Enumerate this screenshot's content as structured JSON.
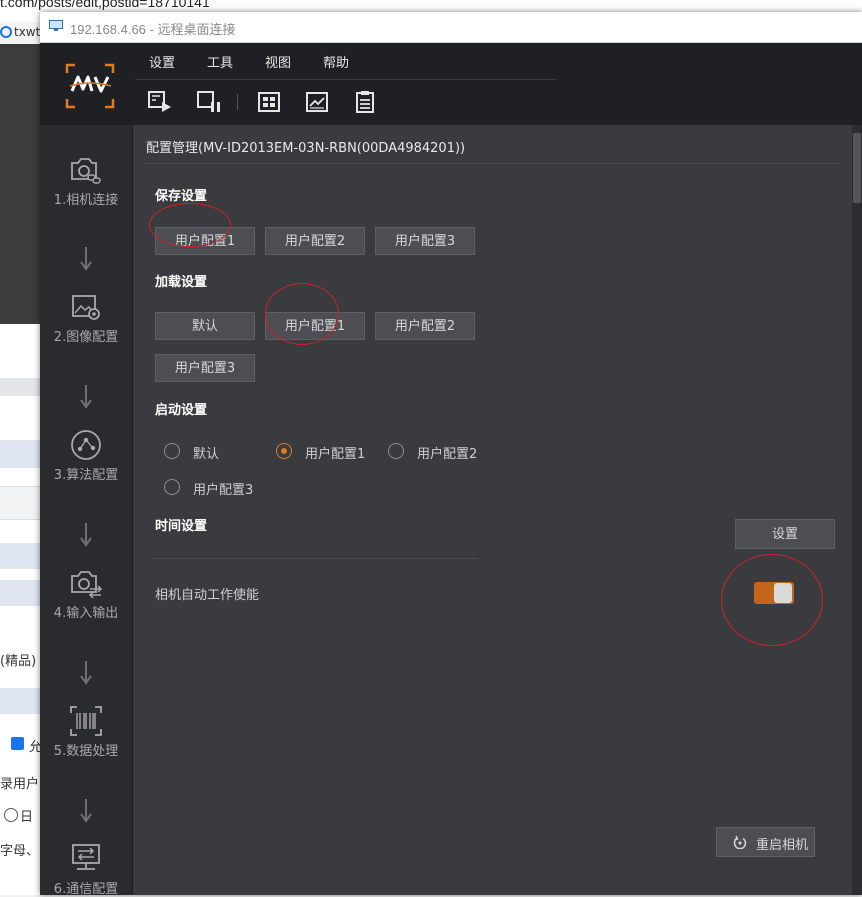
{
  "browser": {
    "url": "t.com/posts/edit,postid=18710141",
    "tab_label": "txwte",
    "left_fragments": [
      "(精品)",
      "允",
      "录用户",
      "日",
      "字母、"
    ]
  },
  "window": {
    "title": "192.168.4.66 - 远程桌面连接"
  },
  "menu": [
    "设置",
    "工具",
    "视图",
    "帮助"
  ],
  "toolbar_icons": [
    "play-icon",
    "pause-icon",
    "layout-icon",
    "chart-icon",
    "document-icon"
  ],
  "steps": [
    {
      "label": "1.相机连接",
      "icon": "camera-link-icon"
    },
    {
      "label": "2.图像配置",
      "icon": "image-settings-icon"
    },
    {
      "label": "3.算法配置",
      "icon": "algorithm-icon"
    },
    {
      "label": "4.输入输出",
      "icon": "io-icon"
    },
    {
      "label": "5.数据处理",
      "icon": "barcode-icon"
    },
    {
      "label": "6.通信配置",
      "icon": "communication-icon"
    }
  ],
  "panel": {
    "title": "配置管理(MV-ID2013EM-03N-RBN(00DA4984201))",
    "save": {
      "title": "保存设置",
      "buttons": [
        "用户配置1",
        "用户配置2",
        "用户配置3"
      ]
    },
    "load": {
      "title": "加载设置",
      "buttons": [
        "默认",
        "用户配置1",
        "用户配置2",
        "用户配置3"
      ]
    },
    "startup": {
      "title": "启动设置",
      "options": [
        "默认",
        "用户配置1",
        "用户配置2",
        "用户配置3"
      ],
      "selected": "用户配置1"
    },
    "time": {
      "title": "时间设置",
      "button": "设置"
    },
    "auto_work": {
      "label": "相机自动工作使能",
      "enabled": true
    },
    "restart_button": "重启相机"
  },
  "colors": {
    "accent": "#e07b23",
    "annotation": "#d0202a",
    "panel_bg": "#3a3b3f"
  }
}
